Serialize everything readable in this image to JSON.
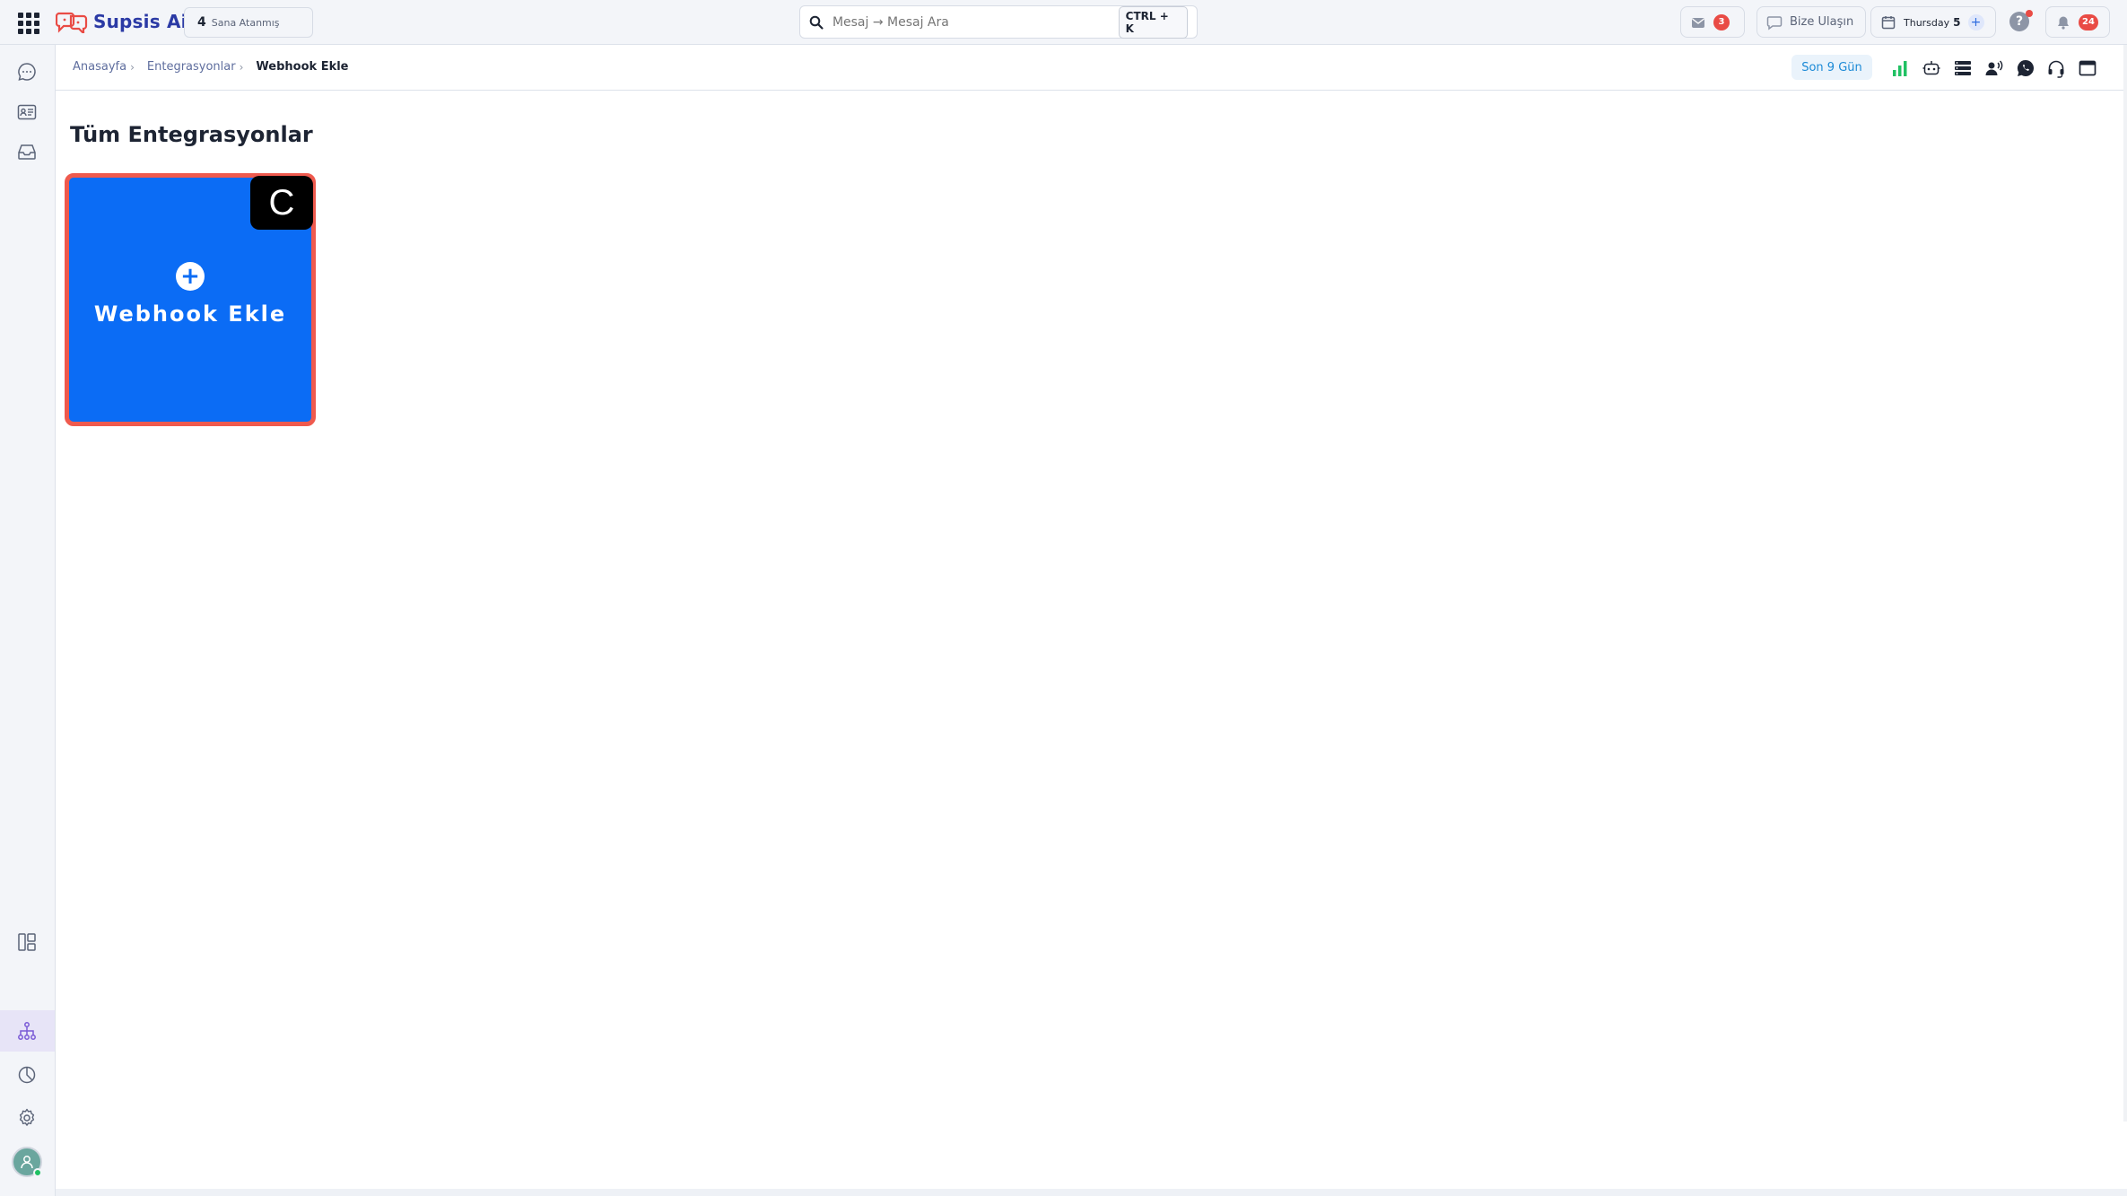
{
  "brand": {
    "name": "Supsis Ai"
  },
  "topbar": {
    "assigned_count": "4",
    "assigned_label": "Sana Atanmış",
    "search_placeholder": "Mesaj → Mesaj Ara",
    "shortcut": "CTRL + K",
    "mail_badge": "3",
    "contact_label": "Bize Ulaşın",
    "day_label": "Thursday",
    "day_num": "5",
    "plus": "+",
    "help": "?",
    "notif_badge": "24"
  },
  "breadcrumb": {
    "items": [
      "Anasayfa",
      "Entegrasyonlar"
    ],
    "separator": "›",
    "current": "Webhook Ekle"
  },
  "subbar": {
    "range_label": "Son 9 Gün"
  },
  "page": {
    "title": "Tüm Entegrasyonlar",
    "card_label": "Webhook Ekle",
    "card_plus": "+",
    "hint_key": "C"
  },
  "colors": {
    "accent": "#0b6cf5",
    "highlight_border": "#ef5a4e",
    "badge": "#e94b45",
    "chart_green": "#20c163"
  }
}
